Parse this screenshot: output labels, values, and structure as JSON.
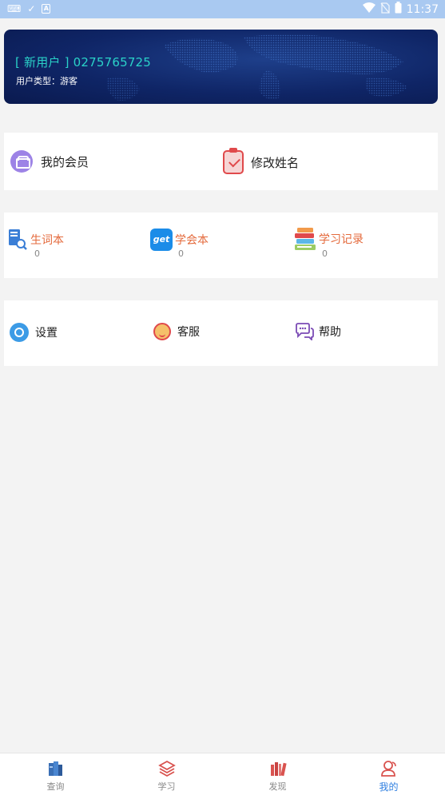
{
  "status_bar": {
    "time": "11:37",
    "battery_icon": "battery-icon",
    "wifi_icon": "wifi-icon"
  },
  "banner": {
    "user_line": "[ 新用户 ] 0275765725",
    "type_label": "用户类型：",
    "type_value": "游客"
  },
  "account": {
    "member_label": "我的会员",
    "rename_label": "修改姓名"
  },
  "study": {
    "items": [
      {
        "label": "生词本",
        "count": "0",
        "icon": "vocabulary-book-icon"
      },
      {
        "label": "学会本",
        "count": "0",
        "icon": "get-icon"
      },
      {
        "label": "学习记录",
        "count": "0",
        "icon": "books-stack-icon"
      }
    ]
  },
  "misc": {
    "settings_label": "设置",
    "service_label": "客服",
    "help_label": "帮助"
  },
  "tabbar": {
    "tabs": [
      {
        "label": "查询"
      },
      {
        "label": "学习"
      },
      {
        "label": "发现"
      },
      {
        "label": "我的"
      }
    ],
    "active_index": 3
  },
  "colors": {
    "accent": "#2f7fe0",
    "banner_text": "#2ad2c8",
    "study_label": "#e46a3c"
  }
}
